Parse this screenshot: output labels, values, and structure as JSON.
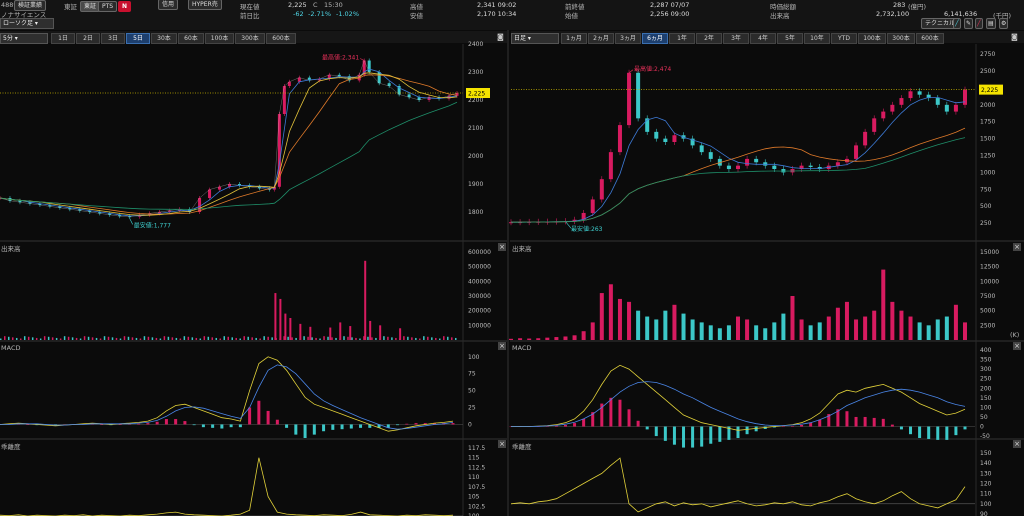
{
  "header": {
    "code": "4889",
    "exchange_badge": "検証業績",
    "real_label": "東証",
    "market_btn": "東証",
    "pts_btn": "PTS",
    "news_icon": "N",
    "credit_btn": "信用",
    "hyper_btn": "HYPER売",
    "company": "ノナサイエンス",
    "current_label": "現在値",
    "current_value": "2,225",
    "current_mark": "C",
    "current_time": "15:30",
    "prev_label": "前日比",
    "change": "-62",
    "change_pct": "-2.71%",
    "change_pct2": "-1.02%",
    "high_label": "高値",
    "high_value": "2,341 09:02",
    "low_label": "安値",
    "low_value": "2,170 10:34",
    "prev_close_label": "前終値",
    "prev_close_value": "2,287 07/07",
    "open_label": "始値",
    "open_value": "2,256 09:00",
    "mcap_label": "時価総額",
    "mcap_value": "283",
    "mcap_unit": "(億円)",
    "volume_label": "出来高",
    "volume_value": "2,732,100",
    "amount_value": "6,141,636",
    "amount_unit": "(千円)",
    "chart_type_select": "ローソク足",
    "technical_btn": "テクニカル"
  },
  "left_toolbar": {
    "interval": "5分",
    "tabs": [
      "1日",
      "2日",
      "3日",
      "5日",
      "30本",
      "60本",
      "100本",
      "300本",
      "600本"
    ],
    "active_tab": "5日"
  },
  "right_toolbar": {
    "interval": "日足",
    "tabs": [
      "1ヵ月",
      "2ヵ月",
      "3ヵ月",
      "6ヵ月",
      "1年",
      "2年",
      "3年",
      "4年",
      "5年",
      "10年",
      "YTD",
      "100本",
      "300本",
      "600本"
    ],
    "active_tab": "6ヵ月"
  },
  "panel_labels": {
    "volume": "出来高",
    "macd": "MACD",
    "psych": "乖離度",
    "vol_unit": "(K)"
  },
  "colors": {
    "up": "#d81b60",
    "down": "#3cc8c8",
    "price_tag_bg": "#f5e400",
    "annot_red": "#e8305a",
    "annot_cyan": "#3fd0d0",
    "ma_blue": "#3d7ad6",
    "ma_orange": "#e07a2a",
    "ma_green": "#1f8f6a",
    "ma_yellow": "#e2c23a",
    "macd_yellow": "#e2d23a",
    "macd_blue": "#4a86e8"
  },
  "chart_data": [
    {
      "id": "intraday-price",
      "type": "line",
      "title": "",
      "x": [
        0,
        10,
        20,
        30,
        40,
        50,
        60,
        70,
        80,
        90,
        100,
        110,
        120,
        130,
        140,
        150,
        160,
        170,
        180,
        190,
        200,
        210,
        220,
        230,
        240,
        250,
        260,
        270,
        275,
        280,
        285,
        290,
        300,
        310,
        320,
        330,
        340,
        350,
        360,
        365,
        370,
        380,
        390,
        400,
        410,
        420,
        430,
        440,
        450,
        458
      ],
      "values": [
        1850,
        1840,
        1835,
        1830,
        1825,
        1820,
        1815,
        1810,
        1805,
        1800,
        1795,
        1790,
        1785,
        1783,
        1790,
        1795,
        1800,
        1805,
        1810,
        1800,
        1850,
        1880,
        1890,
        1900,
        1895,
        1890,
        1885,
        1880,
        1890,
        2150,
        2250,
        2265,
        2280,
        2270,
        2275,
        2290,
        2285,
        2270,
        2290,
        2341,
        2300,
        2260,
        2250,
        2220,
        2210,
        2200,
        2210,
        2205,
        2215,
        2225
      ],
      "ylim": [
        1700,
        2400
      ],
      "yticks": [
        1800,
        1900,
        2000,
        2100,
        2200,
        2300,
        2400
      ],
      "last_price": "2,225",
      "annotations": [
        {
          "text": "最高値:2,341",
          "x": 365,
          "y": 2341,
          "color": "red"
        },
        {
          "text": "最安値:1,777",
          "x": 130,
          "y": 1777,
          "color": "cyan"
        }
      ]
    },
    {
      "id": "intraday-volume",
      "type": "bar",
      "ylim": [
        0,
        600000
      ],
      "yticks": [
        100000,
        200000,
        300000,
        400000,
        500000,
        600000
      ],
      "ytick_labels": [
        "100000",
        "200000",
        "300000",
        "400000",
        "500000",
        "600000"
      ],
      "spikes": [
        [
          275,
          320000
        ],
        [
          280,
          280000
        ],
        [
          285,
          180000
        ],
        [
          290,
          150000
        ],
        [
          300,
          110000
        ],
        [
          310,
          90000
        ],
        [
          330,
          85000
        ],
        [
          340,
          120000
        ],
        [
          350,
          95000
        ],
        [
          365,
          540000
        ],
        [
          370,
          130000
        ],
        [
          380,
          100000
        ],
        [
          400,
          80000
        ]
      ],
      "baseline_level": 20000
    },
    {
      "id": "intraday-macd",
      "type": "line",
      "ylim": [
        -20,
        110
      ],
      "yticks": [
        0,
        25,
        50,
        75,
        100
      ],
      "macd": [
        0,
        1,
        2,
        1,
        0,
        -1,
        -2,
        -1,
        0,
        1,
        2,
        1,
        0,
        1,
        2,
        3,
        5,
        10,
        20,
        28,
        30,
        25,
        20,
        15,
        10,
        8,
        5,
        50,
        90,
        100,
        95,
        80,
        60,
        40,
        30,
        25,
        20,
        15,
        10,
        5,
        0,
        -5,
        -10,
        -8,
        -5,
        -2,
        0,
        2,
        3,
        5
      ],
      "signal": [
        0,
        0,
        1,
        1,
        1,
        0,
        -1,
        -1,
        0,
        0,
        1,
        1,
        1,
        1,
        1,
        2,
        3,
        6,
        12,
        20,
        25,
        26,
        24,
        20,
        16,
        12,
        9,
        25,
        55,
        80,
        88,
        85,
        75,
        60,
        45,
        35,
        28,
        22,
        16,
        10,
        5,
        0,
        -5,
        -7,
        -6,
        -4,
        -2,
        0,
        1,
        3
      ]
    },
    {
      "id": "intraday-deviation",
      "type": "line",
      "ylim": [
        100,
        117.5
      ],
      "yticks": [
        100,
        102.5,
        105,
        107.5,
        110,
        112.5,
        115,
        117.5
      ],
      "values": [
        100.2,
        100.1,
        100.3,
        100.0,
        100.2,
        100.1,
        100.0,
        100.2,
        100.1,
        100.3,
        100.0,
        100.2,
        100.1,
        100.0,
        100.2,
        100.1,
        100.3,
        100.5,
        100.8,
        101.0,
        100.5,
        100.3,
        100.2,
        100.1,
        100.0,
        100.2,
        100.5,
        101.5,
        115,
        105,
        101,
        100.5,
        100.3,
        100.2,
        100.1,
        100.3,
        100.2,
        100.1,
        100.4,
        101,
        100.3,
        100.2,
        100.1,
        100.0,
        100.2,
        100.1,
        100.3,
        100.2,
        100.1,
        100.2
      ]
    },
    {
      "id": "daily-price",
      "type": "line",
      "ylim": [
        0,
        2900
      ],
      "yticks": [
        250,
        500,
        750,
        1000,
        1250,
        1500,
        1750,
        2000,
        2250,
        2500,
        2750
      ],
      "values": [
        263,
        265,
        268,
        270,
        272,
        275,
        280,
        300,
        400,
        600,
        900,
        1300,
        1700,
        2474,
        1800,
        1600,
        1500,
        1450,
        1550,
        1500,
        1400,
        1300,
        1200,
        1100,
        1050,
        1100,
        1200,
        1150,
        1100,
        1050,
        1000,
        1050,
        1100,
        1080,
        1050,
        1100,
        1150,
        1200,
        1400,
        1600,
        1800,
        1900,
        2000,
        2100,
        2200,
        2150,
        2100,
        2000,
        1900,
        2000,
        2225
      ],
      "last_price": "2,225",
      "annotations": [
        {
          "text": "最高値:2,474",
          "index": 13,
          "y": 2474,
          "color": "red"
        },
        {
          "text": "最安値:263",
          "index": 0,
          "y": 263,
          "color": "cyan"
        }
      ]
    },
    {
      "id": "daily-volume",
      "type": "bar",
      "ylim": [
        0,
        15000
      ],
      "yticks": [
        2500,
        5000,
        7500,
        10000,
        12500,
        15000
      ],
      "ytick_labels": [
        "2500",
        "5000",
        "7500",
        "10000",
        "12500",
        "15000"
      ],
      "values": [
        200,
        300,
        250,
        300,
        400,
        500,
        600,
        800,
        1500,
        3000,
        8000,
        9500,
        7000,
        6500,
        5000,
        4000,
        3500,
        5000,
        6000,
        4500,
        3500,
        3000,
        2500,
        2000,
        2500,
        4000,
        3500,
        2500,
        2000,
        3000,
        4500,
        7500,
        3500,
        2500,
        3000,
        4000,
        5500,
        6500,
        3500,
        4000,
        5000,
        12000,
        6500,
        5000,
        4000,
        3000,
        2500,
        3500,
        4000,
        6000,
        3000
      ],
      "unit": "(K)"
    },
    {
      "id": "daily-macd",
      "type": "line",
      "ylim": [
        -60,
        400
      ],
      "yticks": [
        -50,
        0,
        50,
        100,
        150,
        200,
        250,
        300,
        350,
        400
      ],
      "macd": [
        0,
        0,
        0,
        2,
        5,
        10,
        20,
        40,
        80,
        140,
        220,
        290,
        320,
        300,
        260,
        220,
        180,
        140,
        100,
        60,
        40,
        20,
        10,
        0,
        -10,
        -20,
        -15,
        -10,
        -5,
        0,
        5,
        10,
        20,
        40,
        70,
        120,
        170,
        190,
        180,
        200,
        210,
        220,
        200,
        180,
        150,
        120,
        100,
        80,
        60,
        70,
        90
      ],
      "signal": [
        0,
        0,
        0,
        1,
        3,
        6,
        12,
        22,
        40,
        65,
        100,
        140,
        180,
        210,
        230,
        235,
        230,
        215,
        195,
        170,
        150,
        125,
        100,
        80,
        60,
        40,
        25,
        15,
        8,
        5,
        5,
        8,
        12,
        20,
        35,
        55,
        80,
        110,
        130,
        150,
        165,
        180,
        190,
        195,
        190,
        180,
        165,
        150,
        130,
        115,
        105
      ]
    },
    {
      "id": "daily-deviation",
      "type": "line",
      "ylim": [
        88,
        155
      ],
      "yticks": [
        90,
        100,
        110,
        120,
        130,
        140,
        150
      ],
      "values": [
        100,
        101,
        100,
        102,
        103,
        105,
        110,
        115,
        120,
        125,
        130,
        138,
        145,
        100,
        92,
        96,
        100,
        102,
        98,
        101,
        99,
        100,
        97,
        99,
        101,
        103,
        100,
        98,
        99,
        101,
        100,
        102,
        99,
        98,
        101,
        103,
        107,
        110,
        105,
        102,
        100,
        103,
        108,
        112,
        105,
        100,
        98,
        96,
        100,
        104,
        117
      ]
    }
  ]
}
